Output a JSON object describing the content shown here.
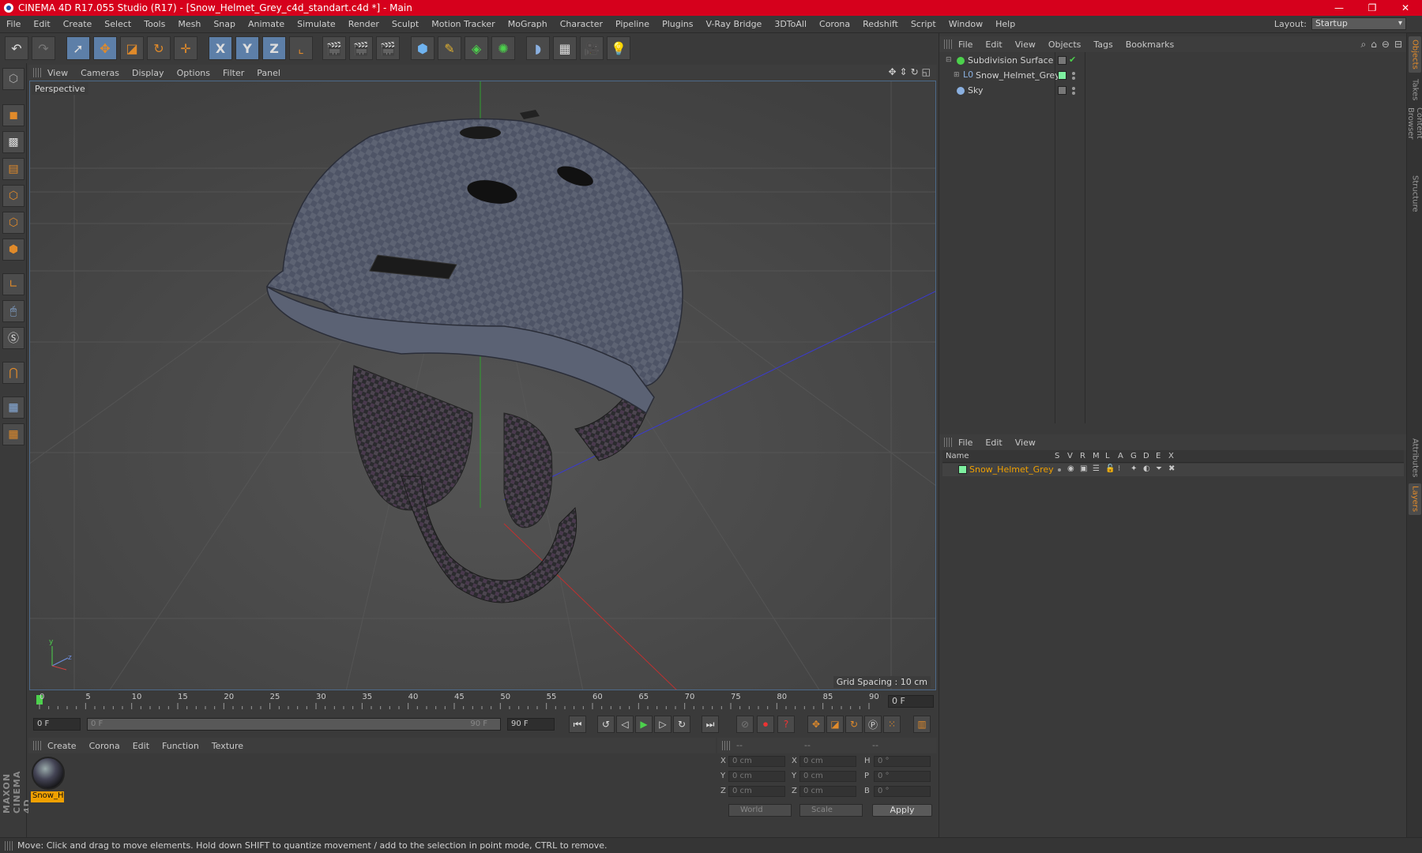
{
  "window": {
    "title": "CINEMA 4D R17.055 Studio (R17) - [Snow_Helmet_Grey_c4d_standart.c4d *] - Main",
    "minimize": "—",
    "maximize": "❐",
    "close": "✕"
  },
  "menubar": {
    "items": [
      "File",
      "Edit",
      "Create",
      "Select",
      "Tools",
      "Mesh",
      "Snap",
      "Animate",
      "Simulate",
      "Render",
      "Sculpt",
      "Motion Tracker",
      "MoGraph",
      "Character",
      "Pipeline",
      "Plugins",
      "V-Ray Bridge",
      "3DToAll",
      "Corona",
      "Redshift",
      "Script",
      "Window",
      "Help"
    ],
    "layout_label": "Layout:",
    "layout_value": "Startup"
  },
  "toolbar": {
    "x_axis": "X",
    "y_axis": "Y",
    "z_axis": "Z"
  },
  "viewport": {
    "menu": [
      "View",
      "Cameras",
      "Display",
      "Options",
      "Filter",
      "Panel"
    ],
    "camera_label": "Perspective",
    "grid_spacing": "Grid Spacing : 10 cm"
  },
  "timeline": {
    "ticks": [
      "0",
      "5",
      "10",
      "15",
      "20",
      "25",
      "30",
      "35",
      "40",
      "45",
      "50",
      "55",
      "60",
      "65",
      "70",
      "75",
      "80",
      "85",
      "90"
    ],
    "current_frame": "0 F"
  },
  "transport": {
    "start_frame": "0 F",
    "range_start": "0 F",
    "range_end": "90 F",
    "end_frame": "90 F"
  },
  "material_manager": {
    "menu": [
      "Create",
      "Corona",
      "Edit",
      "Function",
      "Texture"
    ],
    "material_name": "Snow_H"
  },
  "coordinates": {
    "header": [
      "--",
      "--",
      "--"
    ],
    "rows": [
      {
        "axis1": "X",
        "val1": "0 cm",
        "axis2": "X",
        "val2": "0 cm",
        "axis3": "H",
        "val3": "0 °"
      },
      {
        "axis1": "Y",
        "val1": "0 cm",
        "axis2": "Y",
        "val2": "0 cm",
        "axis3": "P",
        "val3": "0 °"
      },
      {
        "axis1": "Z",
        "val1": "0 cm",
        "axis2": "Z",
        "val2": "0 cm",
        "axis3": "B",
        "val3": "0 °"
      }
    ],
    "space": "World",
    "mode": "Scale",
    "apply": "Apply"
  },
  "object_manager": {
    "menu": [
      "File",
      "Edit",
      "View",
      "Objects",
      "Tags",
      "Bookmarks"
    ],
    "objects": [
      {
        "name": "Subdivision Surface"
      },
      {
        "name": "Snow_Helmet_Grey"
      },
      {
        "name": "Sky"
      }
    ]
  },
  "layer_manager": {
    "menu": [
      "File",
      "Edit",
      "View"
    ],
    "columns": [
      "Name",
      "S",
      "V",
      "R",
      "M",
      "L",
      "A",
      "G",
      "D",
      "E",
      "X"
    ],
    "layers": [
      {
        "name": "Snow_Helmet_Grey",
        "color": "#f0a000"
      }
    ]
  },
  "right_tabs": [
    "Objects",
    "Takes",
    "Content Browser",
    "Structure",
    "Attributes",
    "Layers"
  ],
  "status": "Move: Click and drag to move elements. Hold down SHIFT to quantize movement / add to the selection in point mode, CTRL to remove.",
  "branding": "MAXON CINEMA 4D",
  "colors": {
    "titlebar": "#d6001c",
    "selection_orange": "#f0a000",
    "accent_blue": "#5d7fa8"
  }
}
